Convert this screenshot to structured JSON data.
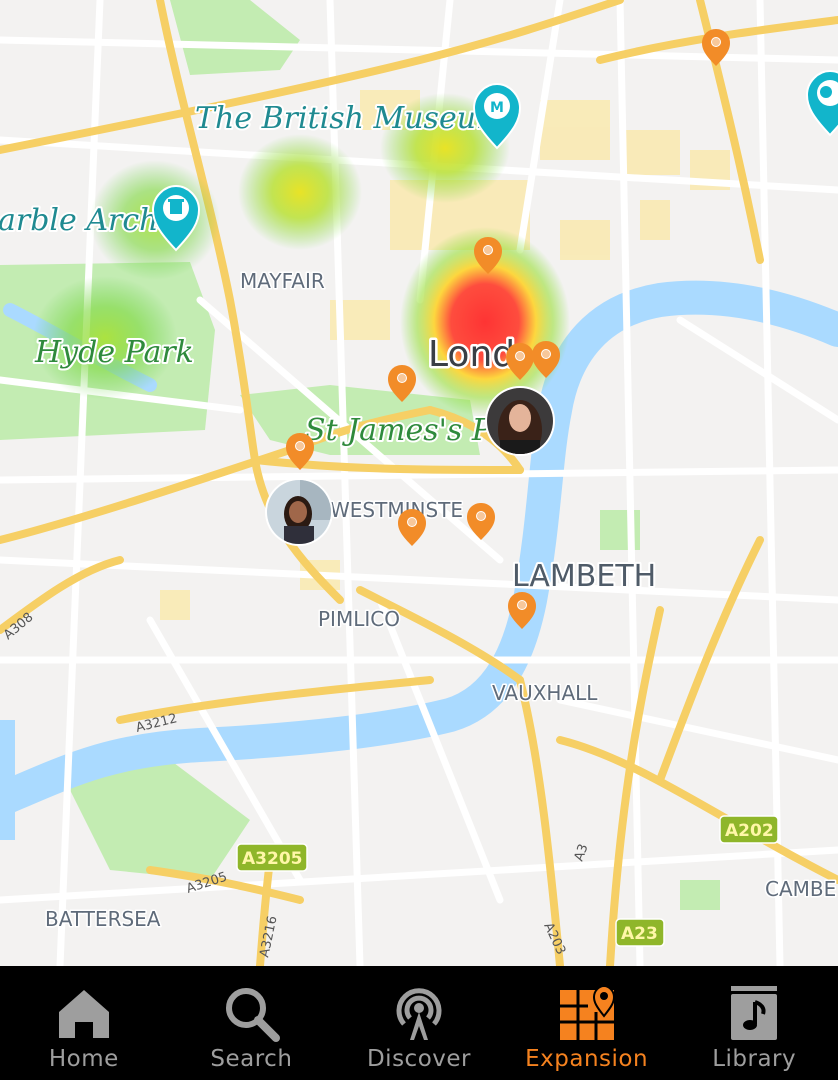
{
  "map": {
    "poi": {
      "british_museum": "The British Museum",
      "marble_arch": "arble Arch",
      "hyde_park": "Hyde Park",
      "st_james": "St James's Pa",
      "london": "Lond"
    },
    "areas": {
      "mayfair": "MAYFAIR",
      "westminster": "WESTMINSTE",
      "lambeth": "LAMBETH",
      "pimlico": "PIMLICO",
      "vauxhall": "VAUXHALL",
      "battersea": "BATTERSEA",
      "camberwell": "CAMBE"
    },
    "roads": {
      "a308": "A308",
      "a3212": "A3212",
      "a3205_small": "A3205",
      "a3216": "A3216",
      "a3": "A3",
      "a203": "A203",
      "a3205_shield": "A3205",
      "a202": "A202",
      "a23": "A23"
    },
    "colors": {
      "land": "#f3f2f1",
      "park": "#c3ecb2",
      "water": "#aadaff",
      "major_road": "#f6cf65",
      "road": "#ffffff",
      "building": "#fbe8a6",
      "marker": "#f28c28",
      "attraction": "#12b5cb"
    }
  },
  "nav": {
    "items": [
      {
        "label": "Home",
        "icon": "home-icon"
      },
      {
        "label": "Search",
        "icon": "search-icon"
      },
      {
        "label": "Discover",
        "icon": "broadcast-icon"
      },
      {
        "label": "Expansion",
        "icon": "map-icon"
      },
      {
        "label": "Library",
        "icon": "music-library-icon"
      }
    ],
    "active": "Expansion",
    "active_color": "#f5821f",
    "inactive_color": "#9e9e9e"
  }
}
